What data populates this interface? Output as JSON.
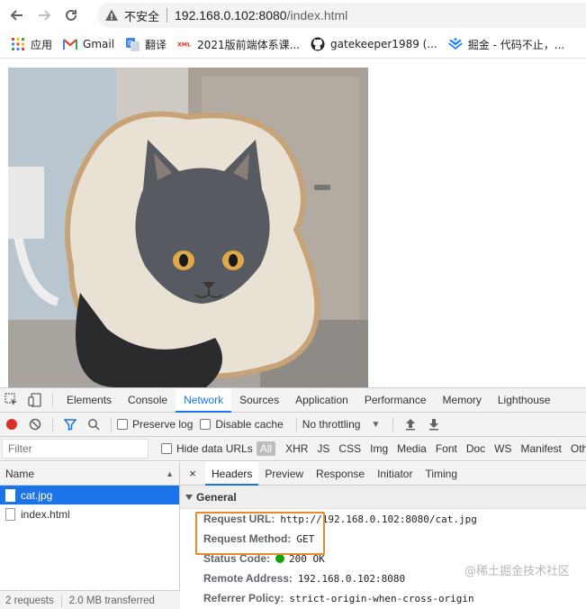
{
  "browser": {
    "security_label": "不安全",
    "url_host": "192.168.0.102:8080",
    "url_path": "/index.html"
  },
  "bookmarks": [
    {
      "label": "应用",
      "icon": "apps-grid-icon"
    },
    {
      "label": "Gmail",
      "icon": "gmail-icon"
    },
    {
      "label": "翻译",
      "icon": "translate-icon"
    },
    {
      "label": "2021版前端体系课...",
      "icon": "xml-icon"
    },
    {
      "label": "gatekeeper1989 (...",
      "icon": "github-icon"
    },
    {
      "label": "掘金 - 代码不止，...",
      "icon": "juejin-icon"
    }
  ],
  "devtools": {
    "tabs": [
      "Elements",
      "Console",
      "Network",
      "Sources",
      "Application",
      "Performance",
      "Memory",
      "Lighthouse"
    ],
    "active_tab": "Network",
    "controls": {
      "preserve_log": "Preserve log",
      "disable_cache": "Disable cache",
      "throttling": "No throttling"
    },
    "filter": {
      "placeholder": "Filter",
      "hide_data_urls": "Hide data URLs",
      "types": [
        "All",
        "XHR",
        "JS",
        "CSS",
        "Img",
        "Media",
        "Font",
        "Doc",
        "WS",
        "Manifest",
        "Other"
      ]
    },
    "request_list": {
      "header": "Name",
      "rows": [
        "cat.jpg",
        "index.html"
      ],
      "status_requests": "2 requests",
      "status_transferred": "2.0 MB transferred"
    },
    "details": {
      "close": "×",
      "tabs": [
        "Headers",
        "Preview",
        "Response",
        "Initiator",
        "Timing"
      ],
      "active_tab": "Headers",
      "section": "General",
      "rows": [
        {
          "key": "Request URL:",
          "value": "http://192.168.0.102:8080/cat.jpg"
        },
        {
          "key": "Request Method:",
          "value": "GET"
        },
        {
          "key": "Status Code:",
          "value": "200 OK"
        },
        {
          "key": "Remote Address:",
          "value": "192.168.0.102:8080"
        },
        {
          "key": "Referrer Policy:",
          "value": "strict-origin-when-cross-origin"
        }
      ]
    },
    "watermark": "@稀土掘金技术社区"
  },
  "colors": {
    "accent": "#1a73e8",
    "highlight": "#e98b2a",
    "status_ok": "#0fa30f",
    "record": "#d93025"
  }
}
